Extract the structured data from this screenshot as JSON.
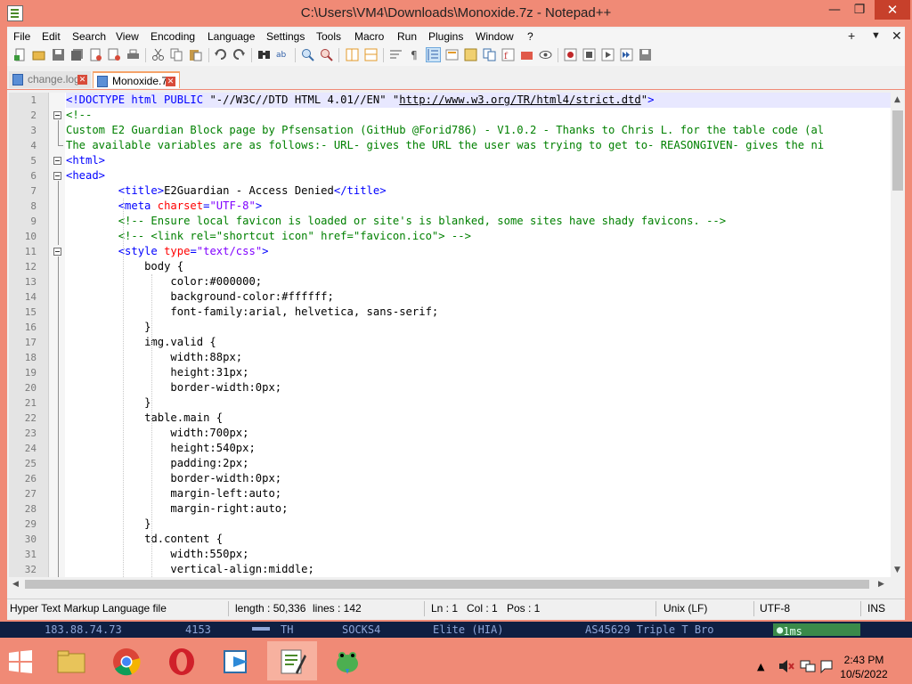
{
  "window": {
    "title": "C:\\Users\\VM4\\Downloads\\Monoxide.7z - Notepad++",
    "minimize": "—",
    "maximize": "❐",
    "close": "✕"
  },
  "menu": [
    "File",
    "Edit",
    "Search",
    "View",
    "Encoding",
    "Language",
    "Settings",
    "Tools",
    "Macro",
    "Run",
    "Plugins",
    "Window",
    "?"
  ],
  "menu_right": {
    "plus": "+",
    "dropdown": "▼",
    "close": "✕"
  },
  "tabs": [
    {
      "label": "change.log",
      "active": false
    },
    {
      "label": "Monoxide.7z",
      "active": true
    }
  ],
  "editor": {
    "lines": [
      {
        "n": "1",
        "html": "<span class=\"t-tag\">&lt;!DOCTYPE html PUBLIC </span><span class=\"t-txt\">\"-//W3C//DTD HTML 4.01//EN\"</span><span class=\"t-tag\"> </span><span class=\"t-txt\">\"</span><span class=\"t-url\">http://www.w3.org/TR/html4/strict.dtd</span><span class=\"t-txt\">\"</span><span class=\"t-tag\">&gt;</span>"
      },
      {
        "n": "2",
        "html": "<span class=\"t-cmt\">&lt;!--</span>"
      },
      {
        "n": "3",
        "html": "<span class=\"t-cmt\">Custom E2 Guardian Block page by Pfsensation (GitHub @Forid786) - V1.0.2 - Thanks to Chris L. for the table code (al</span>"
      },
      {
        "n": "4",
        "html": "<span class=\"t-cmt\">The available variables are as follows:- URL- gives the URL the user was trying to get to- REASONGIVEN- gives the ni</span>"
      },
      {
        "n": "5",
        "html": "<span class=\"t-tag\">&lt;html&gt;</span>"
      },
      {
        "n": "6",
        "html": "<span class=\"t-tag\">&lt;head&gt;</span>"
      },
      {
        "n": "7",
        "html": "        <span class=\"t-tag\">&lt;title&gt;</span><span class=\"t-txt\">E2Guardian - Access Denied</span><span class=\"t-tag\">&lt;/title&gt;</span>"
      },
      {
        "n": "8",
        "html": "        <span class=\"t-tag\">&lt;meta </span><span class=\"t-attr\">charset</span><span class=\"t-tag\">=</span><span class=\"t-val\">\"UTF-8\"</span><span class=\"t-tag\">&gt;</span>"
      },
      {
        "n": "9",
        "html": "        <span class=\"t-cmt\">&lt;!-- Ensure local favicon is loaded or site's is blanked, some sites have shady favicons. --&gt;</span>"
      },
      {
        "n": "10",
        "html": "        <span class=\"t-cmt\">&lt;!-- &lt;link rel=\"shortcut icon\" href=\"favicon.ico\"&gt; --&gt;</span>"
      },
      {
        "n": "11",
        "html": "        <span class=\"t-tag\">&lt;style </span><span class=\"t-attr\">type</span><span class=\"t-tag\">=</span><span class=\"t-val\">\"text/css\"</span><span class=\"t-tag\">&gt;</span>"
      },
      {
        "n": "12",
        "html": "            <span class=\"t-txt\">body {</span>"
      },
      {
        "n": "13",
        "html": "                <span class=\"t-txt\">color:#000000;</span>"
      },
      {
        "n": "14",
        "html": "                <span class=\"t-txt\">background-color:#ffffff;</span>"
      },
      {
        "n": "15",
        "html": "                <span class=\"t-txt\">font-family:arial, helvetica, sans-serif;</span>"
      },
      {
        "n": "16",
        "html": "            <span class=\"t-txt\">}</span>"
      },
      {
        "n": "17",
        "html": "            <span class=\"t-txt\">img.valid {</span>"
      },
      {
        "n": "18",
        "html": "                <span class=\"t-txt\">width:88px;</span>"
      },
      {
        "n": "19",
        "html": "                <span class=\"t-txt\">height:31px;</span>"
      },
      {
        "n": "20",
        "html": "                <span class=\"t-txt\">border-width:0px;</span>"
      },
      {
        "n": "21",
        "html": "            <span class=\"t-txt\">}</span>"
      },
      {
        "n": "22",
        "html": "            <span class=\"t-txt\">table.main {</span>"
      },
      {
        "n": "23",
        "html": "                <span class=\"t-txt\">width:700px;</span>"
      },
      {
        "n": "24",
        "html": "                <span class=\"t-txt\">height:540px;</span>"
      },
      {
        "n": "25",
        "html": "                <span class=\"t-txt\">padding:2px;</span>"
      },
      {
        "n": "26",
        "html": "                <span class=\"t-txt\">border-width:0px;</span>"
      },
      {
        "n": "27",
        "html": "                <span class=\"t-txt\">margin-left:auto;</span>"
      },
      {
        "n": "28",
        "html": "                <span class=\"t-txt\">margin-right:auto;</span>"
      },
      {
        "n": "29",
        "html": "            <span class=\"t-txt\">}</span>"
      },
      {
        "n": "30",
        "html": "            <span class=\"t-txt\">td.content {</span>"
      },
      {
        "n": "31",
        "html": "                <span class=\"t-txt\">width:550px;</span>"
      },
      {
        "n": "32",
        "html": "                <span class=\"t-txt\">vertical-align:middle;</span>"
      }
    ]
  },
  "status": {
    "filetype": "Hyper Text Markup Language file",
    "length": "length : 50,336",
    "lines": "lines : 142",
    "ln": "Ln : 1",
    "col": "Col : 1",
    "pos": "Pos : 1",
    "eol": "Unix (LF)",
    "encoding": "UTF-8",
    "mode": "INS"
  },
  "background_window": {
    "ip": "183.88.74.73",
    "port": "4153",
    "country": "TH",
    "type": "SOCKS4",
    "anonymity": "Elite (HIA)",
    "asn": "AS45629 Triple T Bro",
    "latency": "1ms"
  },
  "taskbar": {
    "time": "2:43 PM",
    "date": "10/5/2022"
  },
  "colors": {
    "frame": "#f08a76",
    "close_button": "#c7402b",
    "comment": "#008000",
    "tag": "#0000ff",
    "attribute": "#ff0000",
    "value": "#8000ff"
  }
}
